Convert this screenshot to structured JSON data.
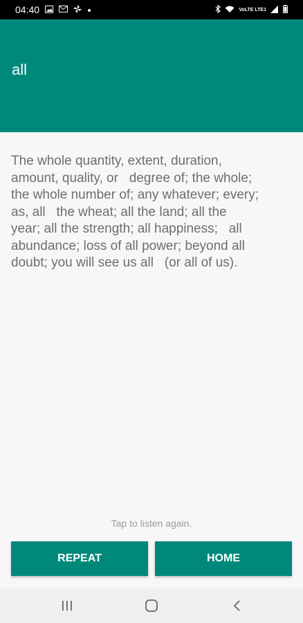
{
  "status_bar": {
    "time": "04:40",
    "notification_icons": [
      "image-icon",
      "mail-icon",
      "pinwheel-icon",
      "dot-icon"
    ],
    "right_icons": [
      "bluetooth-icon",
      "wifi-icon",
      "volte-lte-icon",
      "signal-icon",
      "battery-icon"
    ],
    "carrier_text": "VoLTE LTE1"
  },
  "app_bar": {
    "title": "all",
    "color": "#00897b"
  },
  "definition": {
    "text": "The whole quantity, extent, duration,\namount, quality, or   degree of; the whole;\nthe whole number of; any whatever; every;\nas, all   the wheat; all the land; all the\nyear; all the strength; all happiness;   all\nabundance; loss of all power; beyond all\ndoubt; you will see us all   (or all of us)."
  },
  "hint": {
    "text": "Tap to listen again."
  },
  "buttons": {
    "repeat_label": "REPEAT",
    "home_label": "HOME"
  },
  "nav_bar": {
    "items": [
      "recent-apps",
      "home",
      "back"
    ]
  }
}
